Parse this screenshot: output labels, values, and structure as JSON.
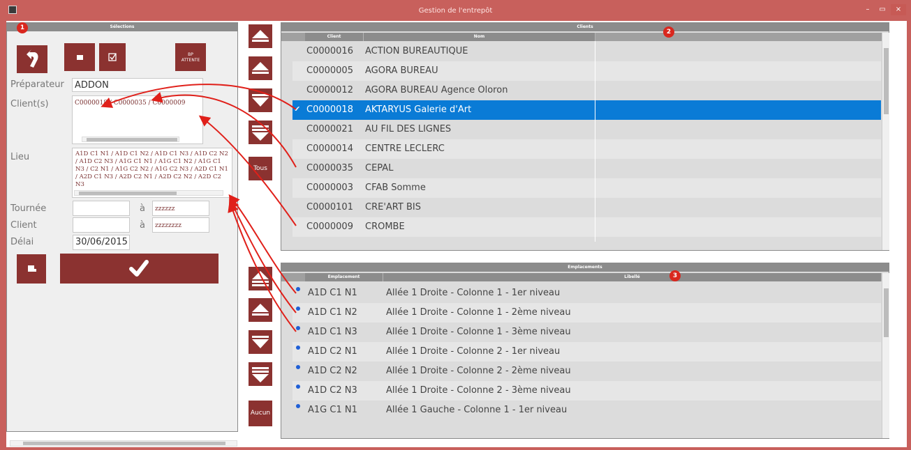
{
  "window": {
    "title": "Gestion de l'entrepôt",
    "controls": [
      "–",
      "▭",
      "×"
    ]
  },
  "left": {
    "header": "Sélections",
    "marker": "1",
    "bp_button_label": "BP\nATTENTE",
    "preparateur_label": "Préparateur",
    "preparateur_value": "ADDON",
    "clients_label": "Client(s)",
    "clients_value": "C0000018 / C0000035 / C0000009",
    "lieu_label": "Lieu",
    "lieu_value": "A1D C1 N1 / A1D C1 N2 / A1D C1 N3 / A1D C2 N2 / A1D C2 N3 / A1G C1 N1 / A1G C1 N2 / A1G C1 N3 / C2 N1 / A1G C2 N2 / A1G C2 N3 / A2D C1 N1 / A2D C1 N3 / A2D C2 N1 / A2D C2 N2 / A2D C2 N3",
    "tournee_label": "Tournée",
    "tournee_from": "",
    "tournee_a": "à",
    "tournee_to": "zzzzzz",
    "client_label": "Client",
    "client_from": "",
    "client_a": "à",
    "client_to": "zzzzzzzz",
    "delai_label": "Délai",
    "delai_value": "30/06/2015"
  },
  "nav": {
    "tous_label": "Tous",
    "aucun_label": "Aucun"
  },
  "clients": {
    "header": "Clients",
    "marker": "2",
    "columns": [
      "Client",
      "Nom"
    ],
    "rows": [
      {
        "code": "C0000016",
        "name": "ACTION BUREAUTIQUE"
      },
      {
        "code": "C0000005",
        "name": "AGORA BUREAU"
      },
      {
        "code": "C0000012",
        "name": "AGORA BUREAU Agence Oloron"
      },
      {
        "code": "C0000018",
        "name": "AKTARYUS Galerie d'Art"
      },
      {
        "code": "C0000021",
        "name": "AU FIL DES LIGNES"
      },
      {
        "code": "C0000014",
        "name": "CENTRE LECLERC"
      },
      {
        "code": "C0000035",
        "name": "CEPAL"
      },
      {
        "code": "C0000003",
        "name": "CFAB Somme"
      },
      {
        "code": "C0000101",
        "name": "CRE'ART BIS"
      },
      {
        "code": "C0000009",
        "name": "CROMBE"
      }
    ]
  },
  "emplacements": {
    "header": "Emplacements",
    "marker": "3",
    "columns": [
      "Emplacement",
      "Libellé"
    ],
    "rows": [
      {
        "code": "A1D C1 N1",
        "label": "Allée 1 Droite - Colonne 1 - 1er niveau"
      },
      {
        "code": "A1D C1 N2",
        "label": "Allée 1 Droite - Colonne 1 - 2ème niveau"
      },
      {
        "code": "A1D C1 N3",
        "label": "Allée 1 Droite - Colonne 1 - 3ème niveau"
      },
      {
        "code": "A1D C2 N1",
        "label": "Allée 1 Droite - Colonne 2 - 1er niveau"
      },
      {
        "code": "A1D C2 N2",
        "label": "Allée 1 Droite - Colonne 2 - 2ème niveau"
      },
      {
        "code": "A1D C2 N3",
        "label": "Allée 1 Droite - Colonne 2 - 3ème niveau"
      },
      {
        "code": "A1G C1 N1",
        "label": "Allée 1 Gauche - Colonne 1 - 1er niveau"
      }
    ]
  },
  "colors": {
    "accent": "#8b3230",
    "title_bar": "#c8605c",
    "selection": "#0a7bd6",
    "marker": "#d9271e",
    "arrow": "#e0201a"
  }
}
